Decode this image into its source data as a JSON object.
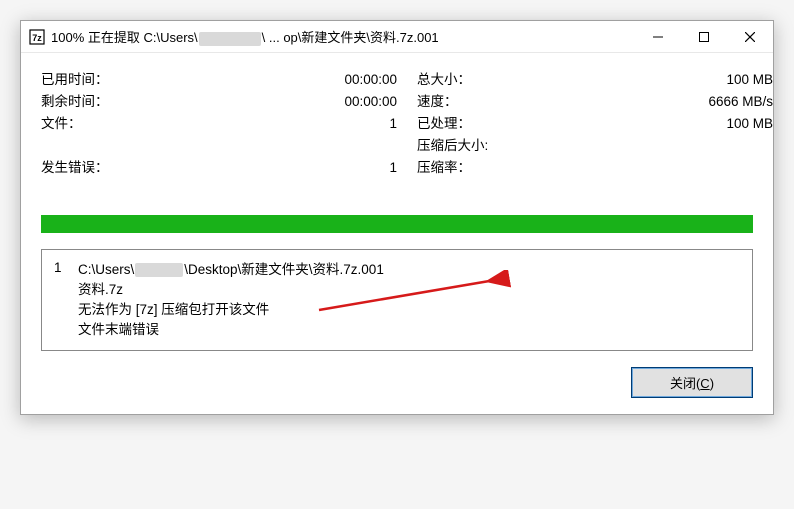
{
  "window": {
    "title_prefix": "100% 正在提取 C:\\Users\\",
    "title_suffix": "\\ ... op\\新建文件夹\\资料.7z.001"
  },
  "stats_left": {
    "elapsed_label": "已用时间：",
    "elapsed_value": "00:00:00",
    "remain_label": "剩余时间：",
    "remain_value": "00:00:00",
    "files_label": "文件：",
    "files_value": "1",
    "errors_label": "发生错误：",
    "errors_value": "1"
  },
  "stats_right": {
    "size_label": "总大小：",
    "size_value": "100 MB",
    "speed_label": "速度：",
    "speed_value": "6666 MB/s",
    "processed_label": "已处理：",
    "processed_value": "100 MB",
    "packed_label": "压缩后大小:",
    "packed_value": "",
    "ratio_label": "压缩率：",
    "ratio_value": ""
  },
  "error": {
    "index": "1",
    "path_prefix": "C:\\Users\\",
    "path_suffix": "\\Desktop\\新建文件夹\\资料.7z.001",
    "line2": "资料.7z",
    "line3": "无法作为 [7z] 压缩包打开该文件",
    "line4": "文件末端错误"
  },
  "buttons": {
    "close_text": "关闭(",
    "close_accel": "C",
    "close_text2": ")"
  }
}
